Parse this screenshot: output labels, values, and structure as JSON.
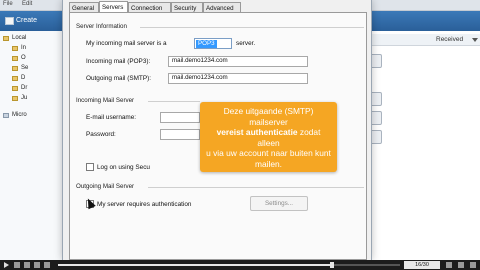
{
  "background_app": {
    "menu": [
      "File",
      "Edit"
    ],
    "create_button": "Create",
    "tree_items": [
      "Local",
      "In",
      "O",
      "Se",
      "D",
      "Dr",
      "Ju",
      "Micro"
    ],
    "list_header": "Received"
  },
  "dialog": {
    "tabs": [
      "General",
      "Servers",
      "Connection",
      "Security",
      "Advanced"
    ],
    "active_tab": "Servers",
    "server_info": {
      "group_label": "Server Information",
      "incoming_type_prefix": "My incoming mail server is a",
      "incoming_type_value": "POP3",
      "incoming_type_suffix": "server.",
      "incoming_label": "Incoming mail (POP3):",
      "incoming_value": "mail.demo1234.com",
      "outgoing_label": "Outgoing mail (SMTP):",
      "outgoing_value": "mail.demo1234.com"
    },
    "incoming_server": {
      "group_label": "Incoming Mail Server",
      "email_username_label": "E-mail username:",
      "password_label": "Password:",
      "log_on_label": "Log on using Secu"
    },
    "outgoing_server": {
      "group_label": "Outgoing Mail Server",
      "requires_auth_label": "My server requires authentication",
      "settings_button": "Settings..."
    }
  },
  "callout": {
    "line1": "Deze uitgaande (SMTP) mailserver",
    "bold": "vereist authenticatie",
    "line2_rest": "zodat alleen",
    "line3": "u via uw account naar buiten kunt",
    "line4": "mailen."
  },
  "video_bar": {
    "page_counter": "16/30",
    "progress": 0.8
  },
  "colors": {
    "callout": "#f5a623",
    "titlebar": "#2a5f99",
    "selection": "#3399ff"
  }
}
